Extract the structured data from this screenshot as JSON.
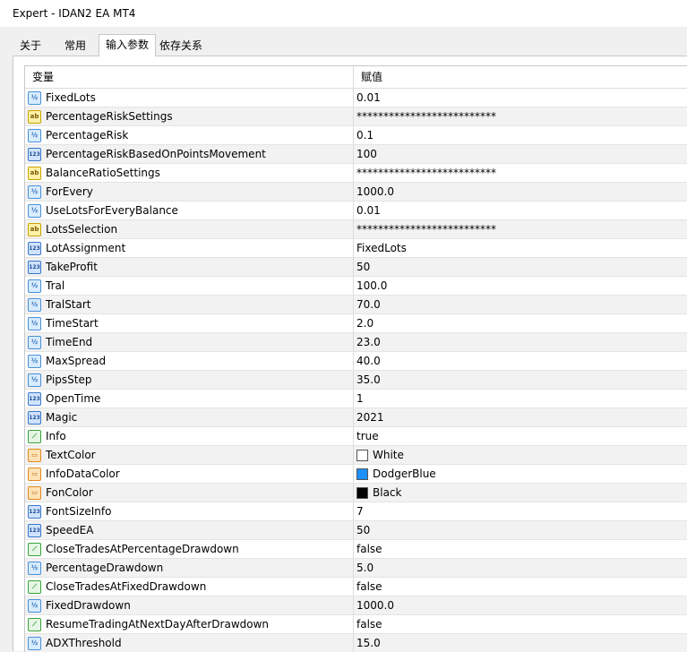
{
  "window": {
    "title": "Expert - IDAN2 EA MT4"
  },
  "tabs": [
    {
      "label": "关于",
      "active": false
    },
    {
      "label": "常用",
      "active": false
    },
    {
      "label": "输入参数",
      "active": true
    },
    {
      "label": "依存关系",
      "active": false
    }
  ],
  "table": {
    "headers": {
      "variable": "变量",
      "value": "赋值"
    },
    "rows": [
      {
        "name": "FixedLots",
        "value": "0.01",
        "icon": "double-variable-icon"
      },
      {
        "name": "PercentageRiskSettings",
        "value": "**************************",
        "icon": "string-variable-icon"
      },
      {
        "name": "PercentageRisk",
        "value": "0.1",
        "icon": "double-variable-icon"
      },
      {
        "name": "PercentageRiskBasedOnPointsMovement",
        "value": "100",
        "icon": "integer-variable-icon"
      },
      {
        "name": "BalanceRatioSettings",
        "value": "**************************",
        "icon": "string-variable-icon"
      },
      {
        "name": "ForEvery",
        "value": "1000.0",
        "icon": "double-variable-icon"
      },
      {
        "name": "UseLotsForEveryBalance",
        "value": "0.01",
        "icon": "double-variable-icon"
      },
      {
        "name": "LotsSelection",
        "value": "**************************",
        "icon": "string-variable-icon"
      },
      {
        "name": "LotAssignment",
        "value": "FixedLots",
        "icon": "integer-variable-icon"
      },
      {
        "name": "TakeProfit",
        "value": "50",
        "icon": "integer-variable-icon"
      },
      {
        "name": "Tral",
        "value": "100.0",
        "icon": "double-variable-icon"
      },
      {
        "name": "TralStart",
        "value": "70.0",
        "icon": "double-variable-icon"
      },
      {
        "name": "TimeStart",
        "value": "2.0",
        "icon": "double-variable-icon"
      },
      {
        "name": "TimeEnd",
        "value": "23.0",
        "icon": "double-variable-icon"
      },
      {
        "name": "MaxSpread",
        "value": "40.0",
        "icon": "double-variable-icon"
      },
      {
        "name": "PipsStep",
        "value": "35.0",
        "icon": "double-variable-icon"
      },
      {
        "name": "OpenTime",
        "value": "1",
        "icon": "integer-variable-icon"
      },
      {
        "name": "Magic",
        "value": "2021",
        "icon": "integer-variable-icon"
      },
      {
        "name": "Info",
        "value": "true",
        "icon": "bool-variable-icon"
      },
      {
        "name": "TextColor",
        "value": "White",
        "icon": "color-variable-icon",
        "swatch": "#ffffff"
      },
      {
        "name": "InfoDataColor",
        "value": "DodgerBlue",
        "icon": "color-variable-icon",
        "swatch": "#1e90ff"
      },
      {
        "name": "FonColor",
        "value": "Black",
        "icon": "color-variable-icon",
        "swatch": "#000000"
      },
      {
        "name": "FontSizeInfo",
        "value": "7",
        "icon": "integer-variable-icon"
      },
      {
        "name": "SpeedEA",
        "value": "50",
        "icon": "integer-variable-icon"
      },
      {
        "name": "CloseTradesAtPercentageDrawdown",
        "value": "false",
        "icon": "bool-variable-icon"
      },
      {
        "name": "PercentageDrawdown",
        "value": "5.0",
        "icon": "double-variable-icon"
      },
      {
        "name": "CloseTradesAtFixedDrawdown",
        "value": "false",
        "icon": "bool-variable-icon"
      },
      {
        "name": "FixedDrawdown",
        "value": "1000.0",
        "icon": "double-variable-icon"
      },
      {
        "name": "ResumeTradingAtNextDayAfterDrawdown",
        "value": "false",
        "icon": "bool-variable-icon"
      },
      {
        "name": "ADXThreshold",
        "value": "15.0",
        "icon": "double-variable-icon"
      }
    ]
  }
}
